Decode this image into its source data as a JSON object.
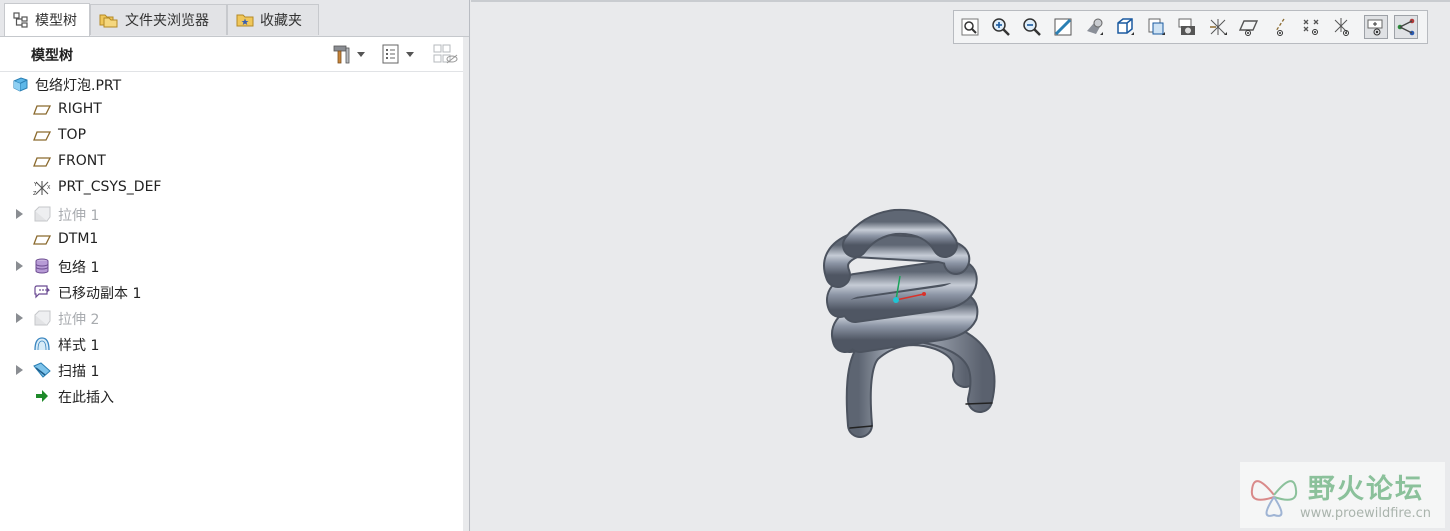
{
  "tabs": [
    {
      "label": "模型树",
      "icon": "model-tree-icon",
      "active": true
    },
    {
      "label": "文件夹浏览器",
      "icon": "folder-browser-icon",
      "active": false
    },
    {
      "label": "收藏夹",
      "icon": "favorites-icon",
      "active": false
    }
  ],
  "tree_header": {
    "title": "模型树",
    "buttons": [
      "settings-hammer-icon",
      "show-options-icon",
      "column-display-icon"
    ]
  },
  "tree": {
    "root": {
      "label": "包络灯泡.PRT",
      "icon": "part-icon"
    },
    "items": [
      {
        "label": "RIGHT",
        "icon": "datum-plane-icon",
        "expandable": false,
        "dimmed": false
      },
      {
        "label": "TOP",
        "icon": "datum-plane-icon",
        "expandable": false,
        "dimmed": false
      },
      {
        "label": "FRONT",
        "icon": "datum-plane-icon",
        "expandable": false,
        "dimmed": false
      },
      {
        "label": "PRT_CSYS_DEF",
        "icon": "coordinate-system-icon",
        "expandable": false,
        "dimmed": false
      },
      {
        "label": "拉伸 1",
        "icon": "extrude-icon",
        "expandable": true,
        "dimmed": true
      },
      {
        "label": "DTM1",
        "icon": "datum-plane-icon",
        "expandable": false,
        "dimmed": false
      },
      {
        "label": "包络 1",
        "icon": "wrap-icon",
        "expandable": true,
        "dimmed": false
      },
      {
        "label": "已移动副本 1",
        "icon": "moved-copy-icon",
        "expandable": false,
        "dimmed": false
      },
      {
        "label": "拉伸 2",
        "icon": "extrude-icon",
        "expandable": true,
        "dimmed": true
      },
      {
        "label": "样式 1",
        "icon": "style-icon",
        "expandable": false,
        "dimmed": false
      },
      {
        "label": "扫描 1",
        "icon": "sweep-icon",
        "expandable": true,
        "dimmed": false
      },
      {
        "label": "在此插入",
        "icon": "insert-here-arrow-icon",
        "expandable": false,
        "dimmed": false
      }
    ]
  },
  "view_toolbar": {
    "buttons": [
      "refit-icon",
      "zoom-in-icon",
      "zoom-out-icon",
      "repaint-icon",
      "display-style-icon",
      "saved-orientations-icon",
      "saved-views-icon",
      "view-manager-icon",
      "datum-display-filters-icon",
      "plane-display-icon",
      "axis-display-icon",
      "point-display-icon",
      "csys-display-icon",
      "spin-center-icon",
      "annotation-display-icon"
    ],
    "pressed": [
      "spin-center-icon",
      "annotation-display-icon"
    ]
  },
  "watermark": {
    "title": "野火论坛",
    "url": "www.proewildfire.cn"
  },
  "colors": {
    "viewport_bg": "#e9eaec",
    "spring_fill": "#8f98a8",
    "plane_icon": "#8b6a2e",
    "insert_arrow": "#1e8a2a",
    "watermark_green": "#8bc19b"
  }
}
